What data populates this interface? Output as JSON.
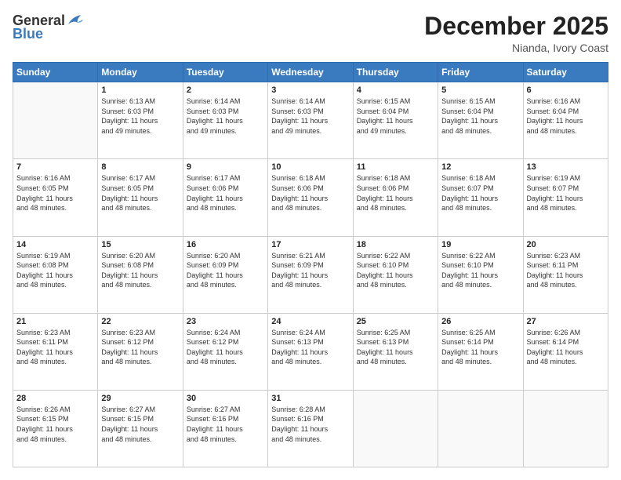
{
  "header": {
    "logo_general": "General",
    "logo_blue": "Blue",
    "month_title": "December 2025",
    "location": "Nianda, Ivory Coast"
  },
  "weekdays": [
    "Sunday",
    "Monday",
    "Tuesday",
    "Wednesday",
    "Thursday",
    "Friday",
    "Saturday"
  ],
  "weeks": [
    [
      {
        "day": "",
        "info": ""
      },
      {
        "day": "1",
        "info": "Sunrise: 6:13 AM\nSunset: 6:03 PM\nDaylight: 11 hours\nand 49 minutes."
      },
      {
        "day": "2",
        "info": "Sunrise: 6:14 AM\nSunset: 6:03 PM\nDaylight: 11 hours\nand 49 minutes."
      },
      {
        "day": "3",
        "info": "Sunrise: 6:14 AM\nSunset: 6:03 PM\nDaylight: 11 hours\nand 49 minutes."
      },
      {
        "day": "4",
        "info": "Sunrise: 6:15 AM\nSunset: 6:04 PM\nDaylight: 11 hours\nand 49 minutes."
      },
      {
        "day": "5",
        "info": "Sunrise: 6:15 AM\nSunset: 6:04 PM\nDaylight: 11 hours\nand 48 minutes."
      },
      {
        "day": "6",
        "info": "Sunrise: 6:16 AM\nSunset: 6:04 PM\nDaylight: 11 hours\nand 48 minutes."
      }
    ],
    [
      {
        "day": "7",
        "info": "Sunrise: 6:16 AM\nSunset: 6:05 PM\nDaylight: 11 hours\nand 48 minutes."
      },
      {
        "day": "8",
        "info": "Sunrise: 6:17 AM\nSunset: 6:05 PM\nDaylight: 11 hours\nand 48 minutes."
      },
      {
        "day": "9",
        "info": "Sunrise: 6:17 AM\nSunset: 6:06 PM\nDaylight: 11 hours\nand 48 minutes."
      },
      {
        "day": "10",
        "info": "Sunrise: 6:18 AM\nSunset: 6:06 PM\nDaylight: 11 hours\nand 48 minutes."
      },
      {
        "day": "11",
        "info": "Sunrise: 6:18 AM\nSunset: 6:06 PM\nDaylight: 11 hours\nand 48 minutes."
      },
      {
        "day": "12",
        "info": "Sunrise: 6:18 AM\nSunset: 6:07 PM\nDaylight: 11 hours\nand 48 minutes."
      },
      {
        "day": "13",
        "info": "Sunrise: 6:19 AM\nSunset: 6:07 PM\nDaylight: 11 hours\nand 48 minutes."
      }
    ],
    [
      {
        "day": "14",
        "info": "Sunrise: 6:19 AM\nSunset: 6:08 PM\nDaylight: 11 hours\nand 48 minutes."
      },
      {
        "day": "15",
        "info": "Sunrise: 6:20 AM\nSunset: 6:08 PM\nDaylight: 11 hours\nand 48 minutes."
      },
      {
        "day": "16",
        "info": "Sunrise: 6:20 AM\nSunset: 6:09 PM\nDaylight: 11 hours\nand 48 minutes."
      },
      {
        "day": "17",
        "info": "Sunrise: 6:21 AM\nSunset: 6:09 PM\nDaylight: 11 hours\nand 48 minutes."
      },
      {
        "day": "18",
        "info": "Sunrise: 6:22 AM\nSunset: 6:10 PM\nDaylight: 11 hours\nand 48 minutes."
      },
      {
        "day": "19",
        "info": "Sunrise: 6:22 AM\nSunset: 6:10 PM\nDaylight: 11 hours\nand 48 minutes."
      },
      {
        "day": "20",
        "info": "Sunrise: 6:23 AM\nSunset: 6:11 PM\nDaylight: 11 hours\nand 48 minutes."
      }
    ],
    [
      {
        "day": "21",
        "info": "Sunrise: 6:23 AM\nSunset: 6:11 PM\nDaylight: 11 hours\nand 48 minutes."
      },
      {
        "day": "22",
        "info": "Sunrise: 6:23 AM\nSunset: 6:12 PM\nDaylight: 11 hours\nand 48 minutes."
      },
      {
        "day": "23",
        "info": "Sunrise: 6:24 AM\nSunset: 6:12 PM\nDaylight: 11 hours\nand 48 minutes."
      },
      {
        "day": "24",
        "info": "Sunrise: 6:24 AM\nSunset: 6:13 PM\nDaylight: 11 hours\nand 48 minutes."
      },
      {
        "day": "25",
        "info": "Sunrise: 6:25 AM\nSunset: 6:13 PM\nDaylight: 11 hours\nand 48 minutes."
      },
      {
        "day": "26",
        "info": "Sunrise: 6:25 AM\nSunset: 6:14 PM\nDaylight: 11 hours\nand 48 minutes."
      },
      {
        "day": "27",
        "info": "Sunrise: 6:26 AM\nSunset: 6:14 PM\nDaylight: 11 hours\nand 48 minutes."
      }
    ],
    [
      {
        "day": "28",
        "info": "Sunrise: 6:26 AM\nSunset: 6:15 PM\nDaylight: 11 hours\nand 48 minutes."
      },
      {
        "day": "29",
        "info": "Sunrise: 6:27 AM\nSunset: 6:15 PM\nDaylight: 11 hours\nand 48 minutes."
      },
      {
        "day": "30",
        "info": "Sunrise: 6:27 AM\nSunset: 6:16 PM\nDaylight: 11 hours\nand 48 minutes."
      },
      {
        "day": "31",
        "info": "Sunrise: 6:28 AM\nSunset: 6:16 PM\nDaylight: 11 hours\nand 48 minutes."
      },
      {
        "day": "",
        "info": ""
      },
      {
        "day": "",
        "info": ""
      },
      {
        "day": "",
        "info": ""
      }
    ]
  ]
}
